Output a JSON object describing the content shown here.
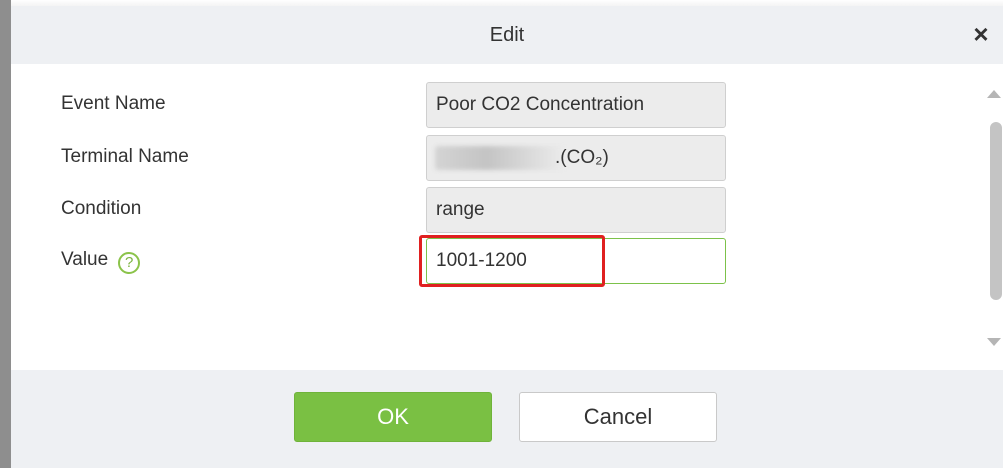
{
  "dialog": {
    "title": "Edit",
    "close_symbol": "×"
  },
  "form": {
    "event_name": {
      "label": "Event Name",
      "value": "Poor CO2 Concentration"
    },
    "terminal_name": {
      "label": "Terminal Name",
      "value": ".(CO₂)"
    },
    "condition": {
      "label": "Condition",
      "value": "range"
    },
    "value": {
      "label": "Value",
      "help_symbol": "?",
      "value": "1001-1200"
    }
  },
  "footer": {
    "ok_label": "OK",
    "cancel_label": "Cancel"
  },
  "colors": {
    "accent_green": "#7ac043",
    "highlight_red": "#e02020",
    "header_bg": "#eef0f3"
  },
  "icons": {
    "close": "close-icon",
    "help": "question-circle-icon",
    "scroll_up": "arrow-up-icon",
    "scroll_down": "arrow-down-icon"
  }
}
